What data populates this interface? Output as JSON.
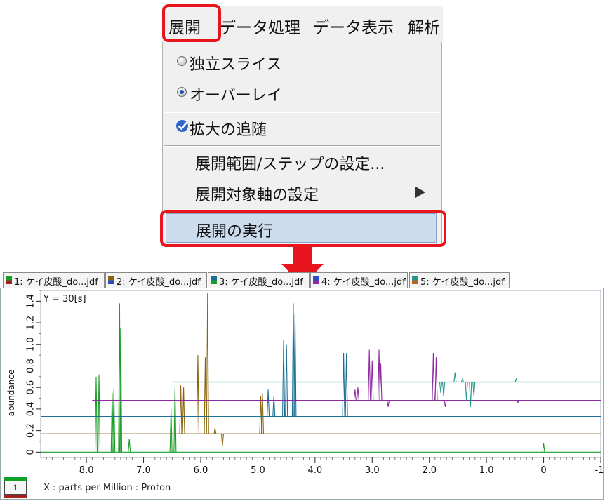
{
  "menu": {
    "titles": [
      "展開",
      "データ処理",
      "データ表示",
      "解析"
    ],
    "items": {
      "independent_slice": "独立スライス",
      "overlay": "オーバーレイ",
      "follow_zoom": "拡大の追随",
      "range_step": "展開範囲/ステップの設定...",
      "axis_setting": "展開対象軸の設定",
      "execute": "展開の実行"
    }
  },
  "tabs": [
    "1: ケイ皮酸_do...jdf",
    "2: ケイ皮酸_do...jdf",
    "3: ケイ皮酸_do...jdf",
    "4: ケイ皮酸_do...jdf",
    "5: ケイ皮酸_do...jdf"
  ],
  "colors": {
    "series1": "#1a9e27",
    "series2": "#8a6410",
    "series3": "#1d6f95",
    "series4": "#8e2aa0",
    "series5": "#24968a",
    "highlight": "#e8141e"
  },
  "plot": {
    "y_annotation": "Y = 30[s]",
    "y_axis_label": "abundance",
    "x_axis_label": "X : parts per Million : Proton",
    "page_number": "1"
  },
  "chart_data": {
    "type": "line",
    "ylabel": "abundance",
    "xlabel": "X : parts per Million : Proton",
    "xlim": [
      8.8,
      -1.0
    ],
    "ylim": [
      -0.05,
      1.5
    ],
    "x_ticks": [
      "8.0",
      "7.0",
      "6.0",
      "5.0",
      "4.0",
      "3.0",
      "2.0",
      "1.0",
      "0",
      "-1."
    ],
    "y_ticks": [
      "0",
      "0.2",
      "0.4",
      "0.6",
      "0.8",
      "1.0",
      "1.2",
      "1.4"
    ],
    "series": [
      {
        "name": "1: ケイ皮酸_do...jdf",
        "baseline": 0.0,
        "x_start": 8.8,
        "peaks": [
          [
            7.83,
            0.7
          ],
          [
            7.78,
            0.72
          ],
          [
            7.55,
            0.55
          ],
          [
            7.52,
            0.58
          ],
          [
            7.42,
            1.38
          ],
          [
            7.4,
            1.15
          ],
          [
            7.25,
            0.12
          ],
          [
            6.52,
            0.4
          ],
          [
            6.45,
            0.6
          ],
          [
            0.0,
            0.08
          ]
        ]
      },
      {
        "name": "2: ケイ皮酸_do...jdf",
        "baseline": 0.17,
        "x_start": 8.8,
        "peaks": [
          [
            6.35,
            0.62
          ],
          [
            6.3,
            0.6
          ],
          [
            6.05,
            0.9
          ],
          [
            5.92,
            0.88
          ],
          [
            5.88,
            1.48
          ],
          [
            5.75,
            0.22
          ],
          [
            5.62,
            0.06
          ],
          [
            4.95,
            0.52
          ],
          [
            4.92,
            0.54
          ]
        ]
      },
      {
        "name": "3: ケイ皮酸_do...jdf",
        "baseline": 0.33,
        "x_start": 8.8,
        "peaks": [
          [
            4.82,
            0.58
          ],
          [
            4.72,
            0.52
          ],
          [
            4.55,
            1.04
          ],
          [
            4.5,
            1.0
          ],
          [
            4.38,
            1.38
          ],
          [
            4.35,
            1.28
          ],
          [
            3.5,
            0.92
          ],
          [
            3.45,
            0.92
          ]
        ]
      },
      {
        "name": "4: ケイ皮酸_do...jdf",
        "baseline": 0.48,
        "x_start": 7.9,
        "peaks": [
          [
            3.3,
            0.58
          ],
          [
            3.25,
            0.6
          ],
          [
            3.05,
            0.95
          ],
          [
            3.0,
            0.85
          ],
          [
            2.88,
            0.95
          ],
          [
            2.85,
            0.82
          ],
          [
            2.72,
            0.42
          ],
          [
            1.93,
            0.92
          ],
          [
            1.88,
            0.88
          ],
          [
            1.72,
            0.42
          ],
          [
            0.45,
            0.46
          ]
        ]
      },
      {
        "name": "5: ケイ皮酸_do...jdf",
        "baseline": 0.65,
        "x_start": 6.5,
        "peaks": [
          [
            1.8,
            0.55
          ],
          [
            1.75,
            0.52
          ],
          [
            1.55,
            0.74
          ],
          [
            1.42,
            0.68
          ],
          [
            1.35,
            0.48
          ],
          [
            1.28,
            0.42
          ],
          [
            1.22,
            0.52
          ],
          [
            0.48,
            0.68
          ]
        ]
      }
    ]
  }
}
